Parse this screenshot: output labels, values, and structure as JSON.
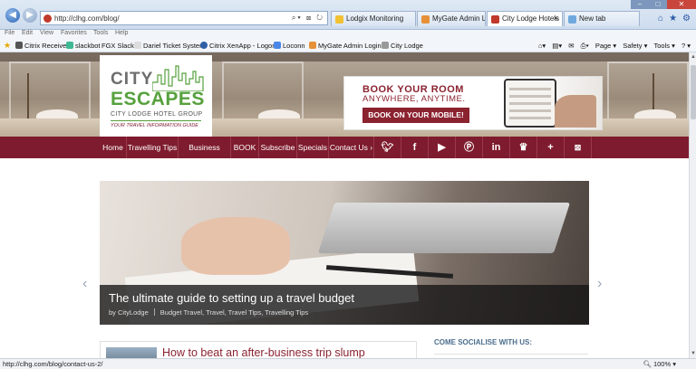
{
  "browser": {
    "url": "http://clhg.com/blog/",
    "menu": [
      "File",
      "Edit",
      "View",
      "Favorites",
      "Tools",
      "Help"
    ],
    "tabs": [
      {
        "label": "Lodgix Monitoring",
        "color": "#f1c232",
        "active": false
      },
      {
        "label": "MyGate Admin Login",
        "color": "#e69138",
        "active": false
      },
      {
        "label": "City Lodge Hotels",
        "color": "#c0392b",
        "active": true
      },
      {
        "label": "New tab",
        "color": "#6fa8dc",
        "active": false
      }
    ],
    "favorites": [
      {
        "label": "Citrix Receiver",
        "color": "#555555"
      },
      {
        "label": "slackbot",
        "color": "#3eb991"
      },
      {
        "label": "FGX Slack",
        "color": "#ffffff"
      },
      {
        "label": "Dariel Ticket System",
        "color": "#ffffff"
      },
      {
        "label": "Citrix XenApp - Logon",
        "color": "#2f5fa7"
      },
      {
        "label": "Loconn",
        "color": "#4a86e8"
      },
      {
        "label": "MyGate Admin Login",
        "color": "#e69138"
      },
      {
        "label": "City Lodge",
        "color": "#999999"
      }
    ],
    "command_bar": [
      "Page ▾",
      "Safety ▾",
      "Tools ▾",
      "? ▾"
    ],
    "status_url": "http://clhg.com/blog/contact-us-2/",
    "zoom": "100%"
  },
  "site": {
    "logo": {
      "line1": "CITY",
      "line2": "ESCAPES",
      "group": "CITY LODGE HOTEL GROUP",
      "tagline": "YOUR TRAVEL INFORMATION GUIDE"
    },
    "banner": {
      "line1": "BOOK YOUR ROOM",
      "line2": "ANYWHERE, ANYTIME.",
      "cta": "BOOK ON YOUR MOBILE!"
    },
    "nav": [
      "Home",
      "Travelling Tips",
      "Business Travel",
      "BOOK",
      "Subscribe",
      "Specials",
      "Contact Us"
    ],
    "nav_dropdown_marker": "›",
    "social": [
      "twitter",
      "facebook",
      "youtube",
      "pinterest",
      "linkedin",
      "crown",
      "plus",
      "close"
    ],
    "slide": {
      "title": "The ultimate guide to setting up a travel budget",
      "author": "by CityLodge",
      "categories": "Budget Travel, Travel, Travel Tips, Travelling Tips"
    },
    "post_title": "How to beat an after-business trip slump",
    "sidebar_title": "COME SOCIALISE WITH US:"
  },
  "colors": {
    "brand_maroon": "#7e1b2e",
    "brand_green": "#56a13d"
  }
}
